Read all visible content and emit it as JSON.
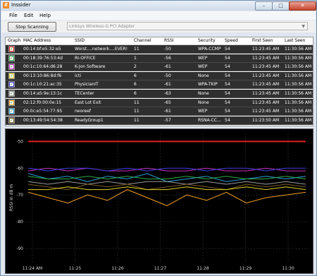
{
  "window": {
    "title": "Inssider",
    "min": "–",
    "max": "□",
    "close": "✕"
  },
  "menu": [
    "File",
    "Edit",
    "Help"
  ],
  "toolbar": {
    "stop_label": "Stop Scanning",
    "adapter_value": "Linksys Wireless-G PCI Adapter"
  },
  "columns": [
    "Graph",
    "MAC Address",
    "SSID",
    "Channel",
    "RSSI",
    "Security",
    "Speed",
    "First Seen",
    "Last Seen"
  ],
  "rows": [
    {
      "color": "#e01e1e",
      "mac": "00:14:bf:e5:32:e5",
      "ssid": "Worst....network....EVER!",
      "channel": "11",
      "rssi": "-50",
      "security": "WPA-CCMP",
      "speed": "54",
      "first": "11:23:45 AM",
      "last": "11:30:56 AM"
    },
    {
      "color": "#2ea84a",
      "mac": "00:18:39:76:53:4d",
      "ssid": "RI-OFFICE",
      "channel": "1",
      "rssi": "-56",
      "security": "WEP",
      "speed": "54",
      "first": "11:23:45 AM",
      "last": "11:30:56 AM"
    },
    {
      "color": "#c02fc0",
      "mac": "00:1c:10:64:d6:28",
      "ssid": "K-Jon Software",
      "channel": "2",
      "rssi": "-61",
      "security": "WEP",
      "speed": "54",
      "first": "11:23:45 AM",
      "last": "11:30:56 AM"
    },
    {
      "color": "#e0d21e",
      "mac": "00:13:10:86:8d:f6",
      "ssid": "icti",
      "channel": "6",
      "rssi": "-50",
      "security": "None",
      "speed": "54",
      "first": "11:23:45 AM",
      "last": "11:30:56 AM"
    },
    {
      "color": "#3a3ae0",
      "mac": "00:1c:10:21:ac:35",
      "ssid": "PhysicianIT",
      "channel": "6",
      "rssi": "-61",
      "security": "WPA-TKIP",
      "speed": "54",
      "first": "11:23:45 AM",
      "last": "11:30:56 AM"
    },
    {
      "color": "#9a9a9a",
      "mac": "00:14:a5:9e:13:1c",
      "ssid": "TECenter",
      "channel": "6",
      "rssi": "-63",
      "security": "None",
      "speed": "54",
      "first": "11:23:45 AM",
      "last": "11:30:56 AM"
    },
    {
      "color": "#f0a020",
      "mac": "02:12:f0:00:0e:15",
      "ssid": "East Lot Exit",
      "channel": "11",
      "rssi": "-65",
      "security": "None",
      "speed": "54",
      "first": "11:23:45 AM",
      "last": "11:30:56 AM"
    },
    {
      "color": "#2aa0d8",
      "mac": "00:0c:e5:54:77:95",
      "ssid": "neoreef",
      "channel": "11",
      "rssi": "-61",
      "security": "WEP",
      "speed": "54",
      "first": "11:23:45 AM",
      "last": "11:30:56 AM"
    },
    {
      "color": "#7a5a1e",
      "mac": "00:13:49:54:54:38",
      "ssid": "ReadyGroup1",
      "channel": "11",
      "rssi": "-57",
      "security": "RSNA-CC...",
      "speed": "54",
      "first": "11:23:50 AM",
      "last": "11:30:56 AM"
    }
  ],
  "chart_data": {
    "type": "line",
    "ylabel": "RSSI in dB m",
    "yticks": [
      "-50",
      "-60",
      "-70",
      "-80",
      "-90"
    ],
    "ylim": [
      -95,
      -47
    ],
    "xticks": [
      "11:24 AM",
      "11:25",
      "11:26",
      "11:27",
      "11:28",
      "11:29",
      "11:30"
    ],
    "x": [
      0,
      0.5,
      1,
      1.5,
      2,
      2.5,
      3,
      3.5,
      4,
      4.5,
      5,
      5.5,
      6,
      6.5,
      7
    ],
    "grid": true,
    "series": [
      {
        "color": "#e01e1e",
        "values": [
          -50,
          -50,
          -50,
          -50,
          -50,
          -50,
          -50,
          -50,
          -50,
          -50,
          -50,
          -50,
          -50,
          -50,
          -50
        ]
      },
      {
        "color": "#c02fc0",
        "values": [
          -61,
          -60,
          -61,
          -60,
          -61,
          -61,
          -60,
          -61,
          -61,
          -60,
          -61,
          -61,
          -60,
          -61,
          -61
        ]
      },
      {
        "color": "#3a3ae0",
        "values": [
          -60,
          -61,
          -60,
          -60,
          -61,
          -60,
          -61,
          -60,
          -60,
          -61,
          -60,
          -60,
          -61,
          -60,
          -60
        ]
      },
      {
        "color": "#2aa0d8",
        "values": [
          -62,
          -64,
          -63,
          -65,
          -63,
          -64,
          -62,
          -65,
          -64,
          -63,
          -65,
          -64,
          -63,
          -64,
          -63
        ]
      },
      {
        "color": "#2ea84a",
        "values": [
          -63,
          -64,
          -64,
          -63,
          -64,
          -63,
          -64,
          -64,
          -63,
          -64,
          -63,
          -64,
          -64,
          -63,
          -64
        ]
      },
      {
        "color": "#9a9a9a",
        "values": [
          -65,
          -66,
          -65,
          -66,
          -65,
          -66,
          -65,
          -65,
          -66,
          -65,
          -66,
          -65,
          -66,
          -65,
          -66
        ]
      },
      {
        "color": "#7a5a1e",
        "values": [
          -66,
          -67,
          -68,
          -66,
          -67,
          -66,
          -68,
          -67,
          -66,
          -67,
          -68,
          -66,
          -67,
          -66,
          -67
        ]
      },
      {
        "color": "#e0d21e",
        "values": [
          -68,
          -68,
          -67,
          -68,
          -68,
          -67,
          -68,
          -68,
          -67,
          -68,
          -68,
          -67,
          -68,
          -67,
          -68
        ]
      },
      {
        "color": "#f0a020",
        "values": [
          -69,
          -71,
          -73,
          -70,
          -72,
          -68,
          -71,
          -74,
          -70,
          -72,
          -69,
          -73,
          -71,
          -70,
          -69
        ]
      }
    ]
  }
}
